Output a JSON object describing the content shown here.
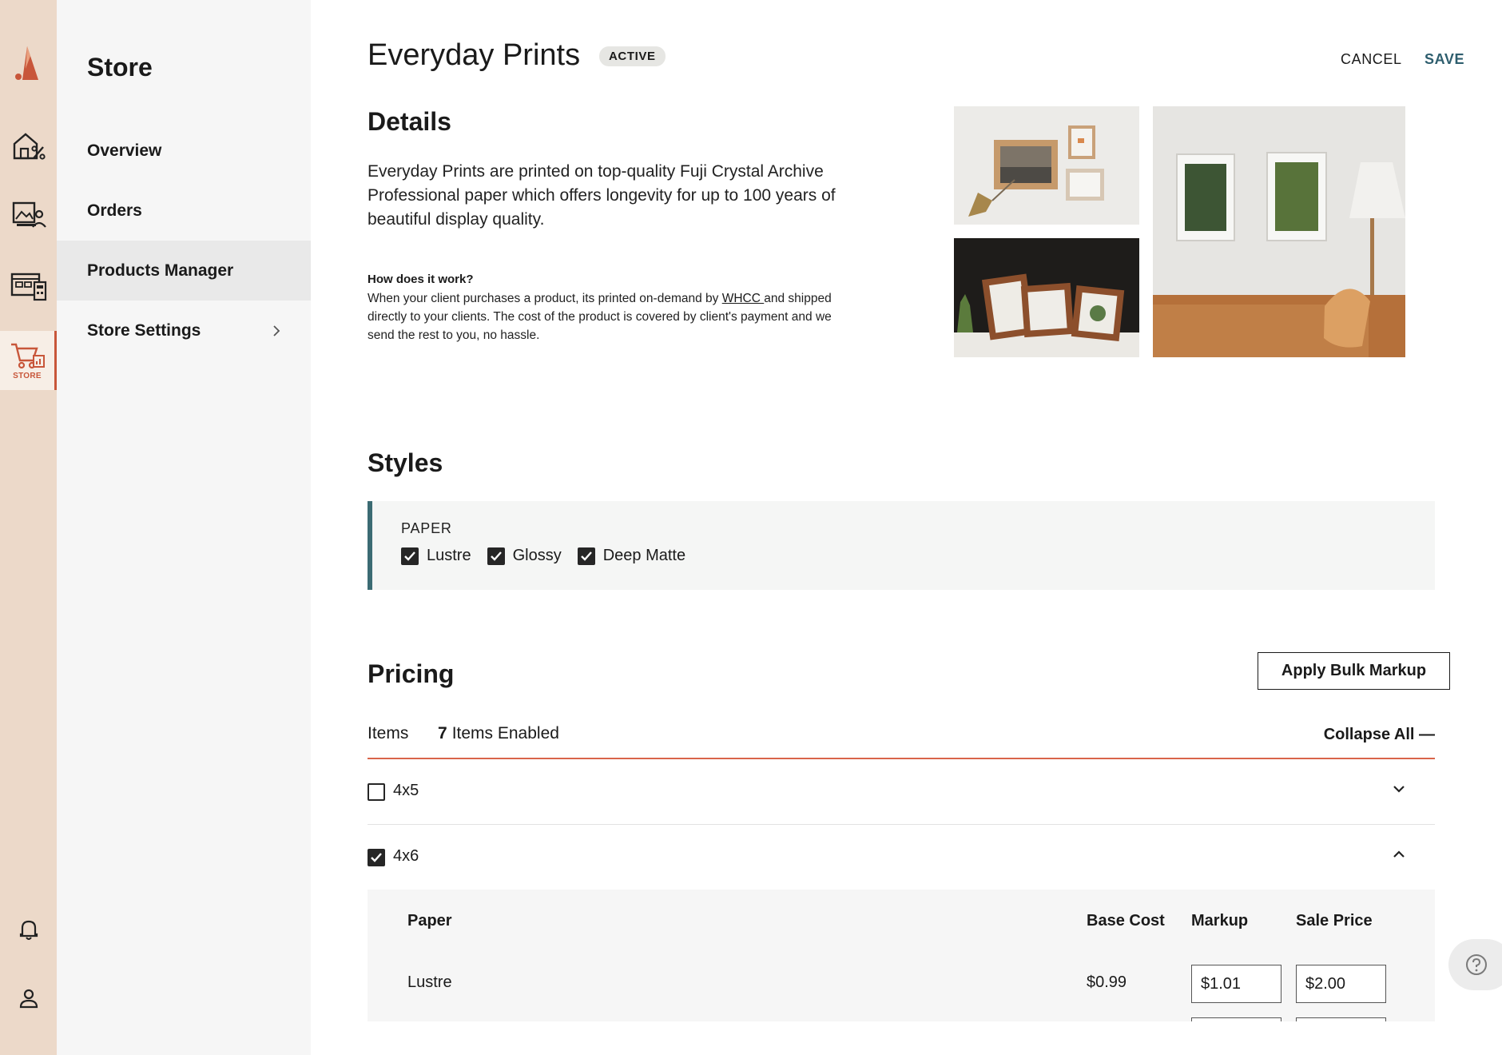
{
  "rail": {
    "items": [
      {
        "icon": "storefront-discount-icon"
      },
      {
        "icon": "gallery-client-icon"
      },
      {
        "icon": "dashboard-calculator-icon"
      },
      {
        "icon": "store-cart-icon",
        "label": "STORE",
        "active": true
      }
    ],
    "bottom": [
      {
        "icon": "bell-icon"
      },
      {
        "icon": "user-icon"
      }
    ]
  },
  "sidebar": {
    "title": "Store",
    "items": [
      {
        "label": "Overview"
      },
      {
        "label": "Orders"
      },
      {
        "label": "Products Manager",
        "active": true
      },
      {
        "label": "Store Settings",
        "has_chevron": true
      }
    ]
  },
  "header": {
    "title": "Everyday Prints",
    "badge": "ACTIVE",
    "cancel_label": "CANCEL",
    "save_label": "SAVE"
  },
  "details": {
    "heading": "Details",
    "description": "Everyday Prints are printed on top-quality Fuji Crystal Archive Professional paper which offers longevity for up to 100 years of beautiful display quality.",
    "how_title": "How does it work?",
    "how_text_before": "When your client purchases a product, its printed on-demand by ",
    "how_link": "WHCC ",
    "how_text_after": "and shipped directly to your clients. The cost of the product is covered by client's payment and we send the rest to you, no hassle."
  },
  "styles": {
    "heading": "Styles",
    "group_label": "PAPER",
    "options": [
      {
        "label": "Lustre",
        "checked": true
      },
      {
        "label": "Glossy",
        "checked": true
      },
      {
        "label": "Deep Matte",
        "checked": true
      }
    ]
  },
  "pricing": {
    "heading": "Pricing",
    "bulk_button": "Apply Bulk Markup",
    "items_label": "Items",
    "enabled_count": "7",
    "enabled_suffix": "Items Enabled",
    "collapse_label": "Collapse All —",
    "sizes": [
      {
        "label": "4x5",
        "checked": false,
        "expanded": false
      },
      {
        "label": "4x6",
        "checked": true,
        "expanded": true
      }
    ],
    "table": {
      "headers": {
        "paper": "Paper",
        "base_cost": "Base Cost",
        "markup": "Markup",
        "sale_price": "Sale Price"
      },
      "rows": [
        {
          "paper": "Lustre",
          "base_cost": "$0.99",
          "markup": "$1.01",
          "sale_price": "$2.00"
        }
      ]
    }
  },
  "colors": {
    "accent": "#c8563a",
    "teal": "#3b6b73",
    "save": "#2e5e6e",
    "rail_bg": "#ecd9c9"
  }
}
